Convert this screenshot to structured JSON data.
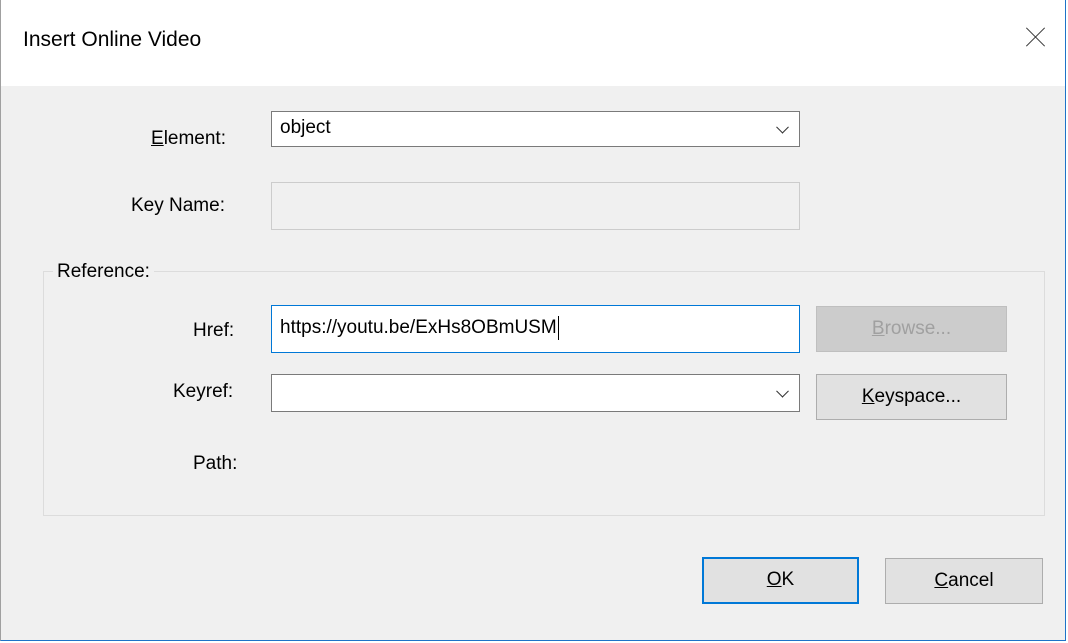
{
  "dialog": {
    "title": "Insert Online Video"
  },
  "element": {
    "label_access": "E",
    "label_rest": "lement:",
    "value": "object"
  },
  "key_name": {
    "label": "Key Name:",
    "value": ""
  },
  "reference": {
    "legend": "Reference:",
    "href": {
      "label": "Href:",
      "value": "https://youtu.be/ExHs8OBmUSM"
    },
    "browse_button": {
      "access": "B",
      "rest": "rowse..."
    },
    "keyref": {
      "label": "Keyref:",
      "value": ""
    },
    "keyspace_button": {
      "access": "K",
      "rest": "eyspace..."
    },
    "path": {
      "label": "Path:",
      "value": ""
    }
  },
  "buttons": {
    "ok": {
      "access": "O",
      "rest": "K"
    },
    "cancel": {
      "access": "C",
      "rest": "ancel"
    }
  },
  "colors": {
    "accent": "#0078d7",
    "dialog_bg": "#f0f0f0"
  },
  "icons": {
    "close": "close-icon",
    "dropdown": "chevron-down-icon"
  }
}
